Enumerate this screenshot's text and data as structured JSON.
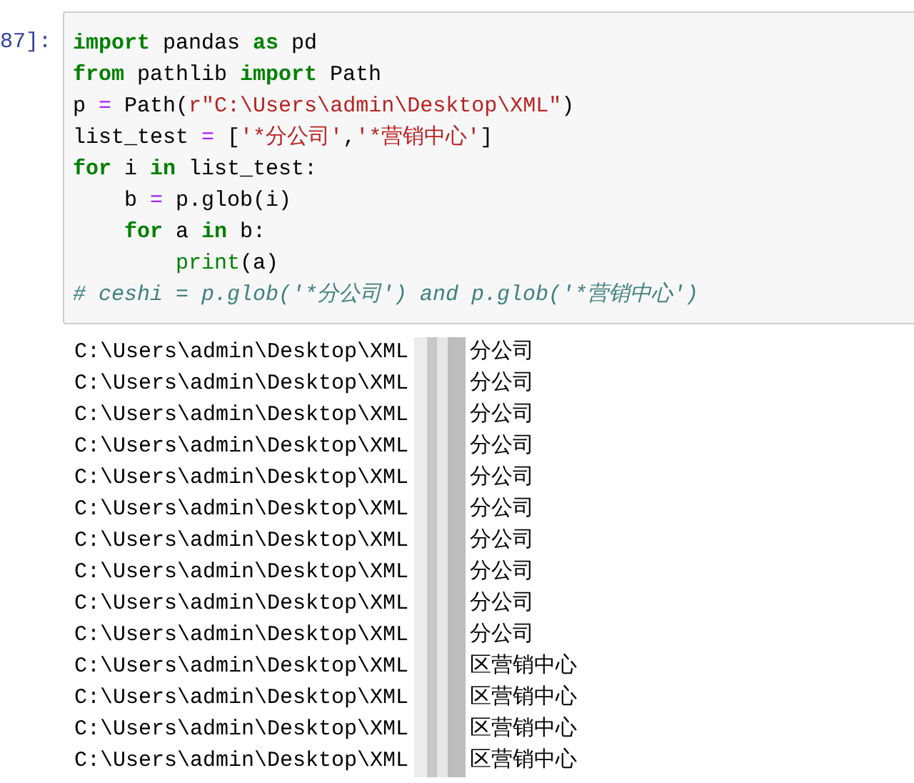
{
  "cell": {
    "prompt": "87]:",
    "code_lines": [
      [
        {
          "kind": "keyword",
          "text": "import"
        },
        {
          "kind": "plain",
          "text": " pandas "
        },
        {
          "kind": "keyword",
          "text": "as"
        },
        {
          "kind": "plain",
          "text": " pd"
        }
      ],
      [
        {
          "kind": "keyword",
          "text": "from"
        },
        {
          "kind": "plain",
          "text": " pathlib "
        },
        {
          "kind": "keyword",
          "text": "import"
        },
        {
          "kind": "plain",
          "text": " Path"
        }
      ],
      [
        {
          "kind": "plain",
          "text": "p "
        },
        {
          "kind": "operator",
          "text": "="
        },
        {
          "kind": "plain",
          "text": " Path("
        },
        {
          "kind": "string",
          "text": "r\"C:\\Users\\admin\\Desktop\\XML\""
        },
        {
          "kind": "plain",
          "text": ")"
        }
      ],
      [
        {
          "kind": "plain",
          "text": "list_test "
        },
        {
          "kind": "operator",
          "text": "="
        },
        {
          "kind": "plain",
          "text": " ["
        },
        {
          "kind": "string",
          "text": "'*分公司'"
        },
        {
          "kind": "plain",
          "text": ","
        },
        {
          "kind": "string",
          "text": "'*营销中心'"
        },
        {
          "kind": "plain",
          "text": "]"
        }
      ],
      [
        {
          "kind": "keyword",
          "text": "for"
        },
        {
          "kind": "plain",
          "text": " i "
        },
        {
          "kind": "keyword",
          "text": "in"
        },
        {
          "kind": "plain",
          "text": " list_test:"
        }
      ],
      [
        {
          "kind": "plain",
          "text": "    b "
        },
        {
          "kind": "operator",
          "text": "="
        },
        {
          "kind": "plain",
          "text": " p.glob(i)"
        }
      ],
      [
        {
          "kind": "keyword",
          "text": "    for"
        },
        {
          "kind": "plain",
          "text": " a "
        },
        {
          "kind": "keyword",
          "text": "in"
        },
        {
          "kind": "plain",
          "text": " b:"
        }
      ],
      [
        {
          "kind": "builtin",
          "text": "        print"
        },
        {
          "kind": "plain",
          "text": "(a)"
        }
      ],
      [
        {
          "kind": "comment",
          "text": "# ceshi = p.glob('*分公司') and p.glob('*营销中心')"
        }
      ]
    ],
    "output_lines": [
      {
        "path": "C:\\Users\\admin\\Desktop\\XML",
        "redacted": true,
        "suffix": "分公司"
      },
      {
        "path": "C:\\Users\\admin\\Desktop\\XML",
        "redacted": true,
        "suffix": "分公司"
      },
      {
        "path": "C:\\Users\\admin\\Desktop\\XML",
        "redacted": true,
        "suffix": "分公司"
      },
      {
        "path": "C:\\Users\\admin\\Desktop\\XML",
        "redacted": true,
        "suffix": "分公司"
      },
      {
        "path": "C:\\Users\\admin\\Desktop\\XML",
        "redacted": true,
        "suffix": "分公司"
      },
      {
        "path": "C:\\Users\\admin\\Desktop\\XML",
        "redacted": true,
        "suffix": "分公司"
      },
      {
        "path": "C:\\Users\\admin\\Desktop\\XML",
        "redacted": true,
        "suffix": "分公司"
      },
      {
        "path": "C:\\Users\\admin\\Desktop\\XML",
        "redacted": true,
        "suffix": "分公司"
      },
      {
        "path": "C:\\Users\\admin\\Desktop\\XML",
        "redacted": true,
        "suffix": "分公司"
      },
      {
        "path": "C:\\Users\\admin\\Desktop\\XML",
        "redacted": true,
        "suffix": "分公司"
      },
      {
        "path": "C:\\Users\\admin\\Desktop\\XML",
        "redacted": true,
        "suffix": "区营销中心"
      },
      {
        "path": "C:\\Users\\admin\\Desktop\\XML",
        "redacted": true,
        "suffix": "区营销中心"
      },
      {
        "path": "C:\\Users\\admin\\Desktop\\XML",
        "redacted": true,
        "suffix": "区营销中心"
      },
      {
        "path": "C:\\Users\\admin\\Desktop\\XML",
        "redacted": true,
        "suffix": "区营销中心"
      }
    ]
  }
}
